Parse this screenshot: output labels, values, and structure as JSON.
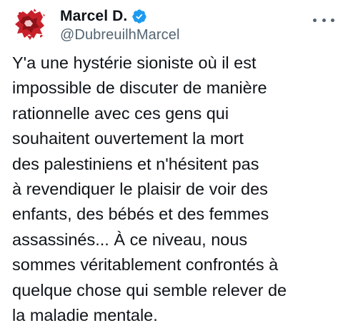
{
  "tweet": {
    "author": {
      "display_name": "Marcel D.",
      "handle": "@DubreuilhMarcel",
      "verified": true,
      "verified_icon": "verified-badge-icon",
      "avatar": "avatar"
    },
    "more_icon": "more-options-icon",
    "text_lines": [
      "Y'a une hystérie sioniste où il est",
      "impossible de discuter de manière",
      "rationnelle avec ces gens qui",
      "souhaitent ouvertement la mort",
      "des palestiniens et n'hésitent pas",
      "à revendiquer le plaisir de voir des",
      "enfants, des bébés et des femmes",
      "assassinés... À ce niveau, nous",
      "sommes véritablement confrontés à",
      "quelque chose qui semble relever de",
      "la maladie mentale."
    ]
  },
  "colors": {
    "text": "#0f1419",
    "secondary_text": "#536471",
    "verified_blue": "#1d9bf0",
    "avatar_red": "#c8202a",
    "background": "#ffffff"
  }
}
